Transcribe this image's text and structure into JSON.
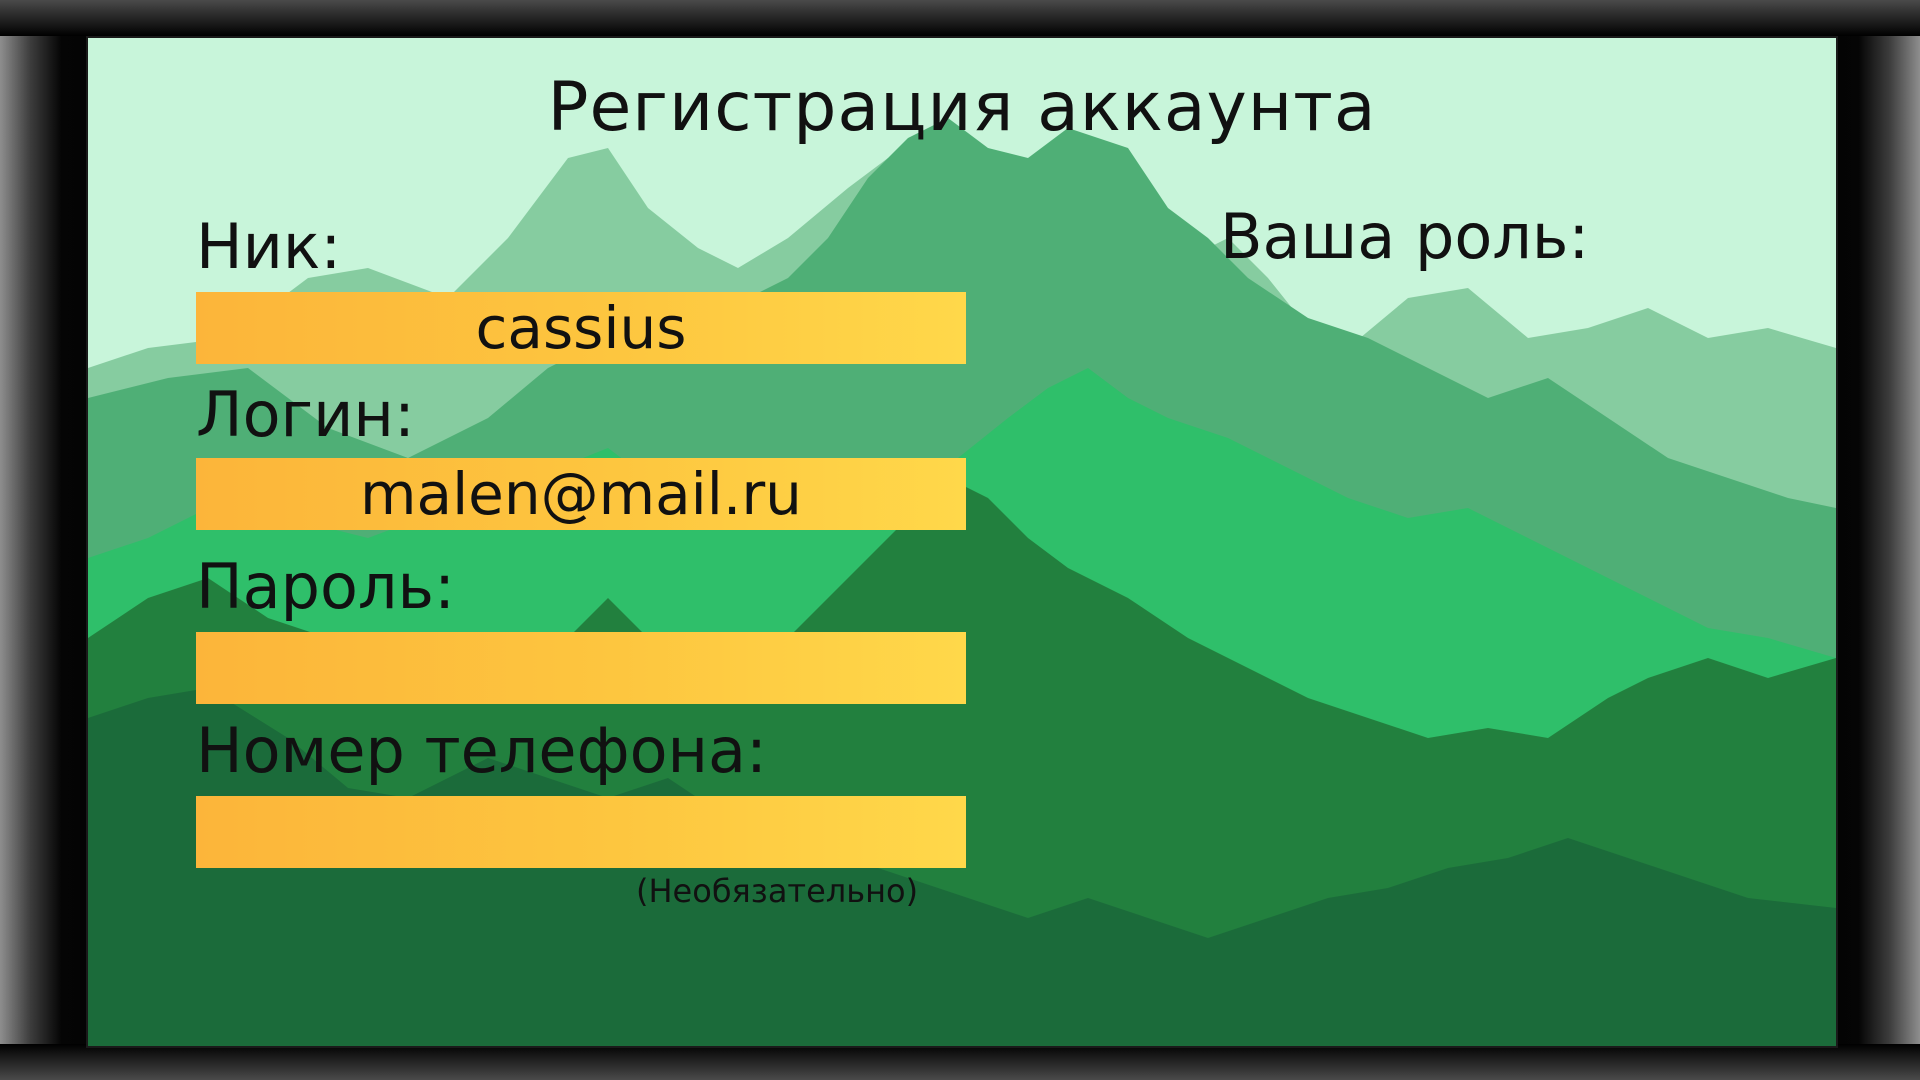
{
  "window": {
    "title": "Регистрация аккаунта"
  },
  "form": {
    "nick": {
      "label": "Ник:",
      "value": "cassius"
    },
    "login": {
      "label": "Логин:",
      "value": "malen@mail.ru"
    },
    "password": {
      "label": "Пароль:",
      "value": ""
    },
    "phone": {
      "label": "Номер телефона:",
      "value": "",
      "hint": "(Необязательно)"
    }
  },
  "role": {
    "label": "Ваша роль:"
  },
  "colors": {
    "screen_bg": "#c8f5da",
    "field_bg": "#fdc63f",
    "mountain_far": "#86cca0",
    "mountain_mid": "#4faf76",
    "mountain_bright": "#2fbf6a",
    "mountain_dark": "#22803e",
    "mountain_darkest": "#1b6b3a"
  }
}
